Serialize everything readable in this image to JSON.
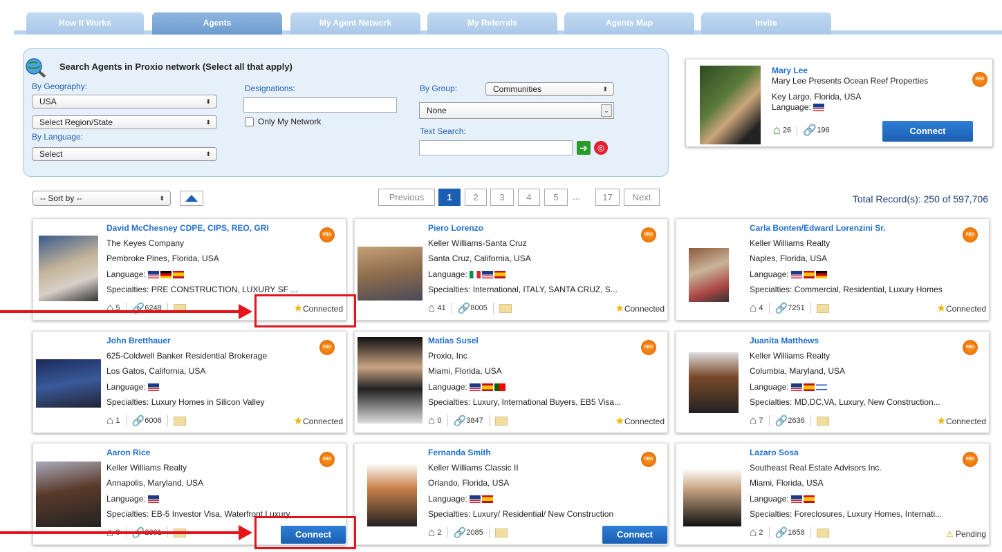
{
  "tabs": [
    {
      "label": "How It Works"
    },
    {
      "label": "Agents"
    },
    {
      "label": "My Agent Network"
    },
    {
      "label": "My Referrals"
    },
    {
      "label": "Agents Map"
    },
    {
      "label": "Invite"
    }
  ],
  "search": {
    "title": "Search Agents in Proxio network (Select all that apply)",
    "by_geography_label": "By Geography:",
    "country_value": "USA",
    "region_value": "Select Region/State",
    "by_language_label": "By Language:",
    "language_value": "Select",
    "designations_label": "Designations:",
    "designations_value": "",
    "only_my_network_label": "Only My Network",
    "by_group_label": "By Group:",
    "group_value": "Communities",
    "group_sub_value": "None",
    "text_search_label": "Text Search:",
    "text_search_value": ""
  },
  "featured": {
    "name": "Mary Lee",
    "company": "Mary Lee Presents Ocean Reef Properties",
    "location": "Key Largo, Florida, USA",
    "language_label": "Language:",
    "listings": "26",
    "connections": "196",
    "connect_label": "Connect"
  },
  "sort_label": "-- Sort by --",
  "pagination": {
    "previous": "Previous",
    "pages": [
      "1",
      "2",
      "3",
      "4",
      "5"
    ],
    "ellipsis": "...",
    "last": "17",
    "next": "Next"
  },
  "total_records": "Total Record(s): 250 of 597,706",
  "agents": [
    {
      "name": "David McChesney CDPE, CIPS, REO, GRI",
      "company": "The Keyes Company",
      "location": "Pembroke Pines, Florida, USA",
      "language_label": "Language:",
      "flags": [
        "us",
        "de",
        "es"
      ],
      "specialties": "Specialties: PRE CONSTRUCTION, LUXURY SF ...",
      "listings": "5",
      "connections": "6248",
      "status": "Connected"
    },
    {
      "name": "Piero Lorenzo",
      "company": "Keller Williams-Santa Cruz",
      "location": "Santa Cruz, California, USA",
      "language_label": "Language:",
      "flags": [
        "it",
        "us",
        "es"
      ],
      "specialties": "Specialties: International, ITALY, SANTA CRUZ, S...",
      "listings": "41",
      "connections": "8005",
      "status": "Connected"
    },
    {
      "name": "Carla Bonten/Edward Lorenzini Sr.",
      "company": "Keller Williams Realty",
      "location": "Naples, Florida, USA",
      "language_label": "Language:",
      "flags": [
        "us",
        "es",
        "de"
      ],
      "specialties": "Specialties: Commercial, Residential, Luxury Homes",
      "listings": "4",
      "connections": "7251",
      "status": "Connected"
    },
    {
      "name": "John Bretthauer",
      "company": "625-Coldwell Banker Residential Brokerage",
      "location": "Los Gatos, California, USA",
      "language_label": "Language:",
      "flags": [
        "us"
      ],
      "specialties": "Specialties: Luxury Homes in Silicon Valley",
      "listings": "1",
      "connections": "6006",
      "status": "Connected"
    },
    {
      "name": "Matias Susel",
      "company": "Proxio, Inc",
      "location": "Miami, Florida, USA",
      "language_label": "Language:",
      "flags": [
        "us",
        "es",
        "pt"
      ],
      "specialties": "Specialties: Luxury, International Buyers, EB5 Visa...",
      "listings": "0",
      "connections": "3847",
      "status": "Connected"
    },
    {
      "name": "Juanita Matthews",
      "company": "Keller Williams Realty",
      "location": "Columbia, Maryland, USA",
      "language_label": "Language:",
      "flags": [
        "us",
        "es",
        "il"
      ],
      "specialties": "Specialties: MD,DC,VA, Luxury, New Construction...",
      "listings": "7",
      "connections": "2636",
      "status": "Connected"
    },
    {
      "name": "Aaron Rice",
      "company": "Keller Williams Realty",
      "location": "Annapolis, Maryland, USA",
      "language_label": "Language:",
      "flags": [
        "us"
      ],
      "specialties": "Specialties: EB-5 Investor Visa, Waterfront Luxury",
      "listings": "9",
      "connections": "2391",
      "status": "Connect"
    },
    {
      "name": "Fernanda Smith",
      "company": "Keller Williams Classic II",
      "location": "Orlando, Florida, USA",
      "language_label": "Language:",
      "flags": [
        "us",
        "es"
      ],
      "specialties": "Specialties: Luxury/ Residential/ New Construction",
      "listings": "2",
      "connections": "2085",
      "status": "Connect"
    },
    {
      "name": "Lazaro Sosa",
      "company": "Southeast Real Estate Advisors Inc.",
      "location": "Miami, Florida, USA",
      "language_label": "Language:",
      "flags": [
        "us",
        "es"
      ],
      "specialties": "Specialties: Foreclosures, Luxury Homes, Internati...",
      "listings": "2",
      "connections": "1658",
      "status": "Pending"
    }
  ],
  "pro_badge": "PRO",
  "colors": {
    "accent": "#1b5fb2",
    "link": "#1f6fcf",
    "annotation": "#e3141b",
    "pro": "#e06000"
  }
}
